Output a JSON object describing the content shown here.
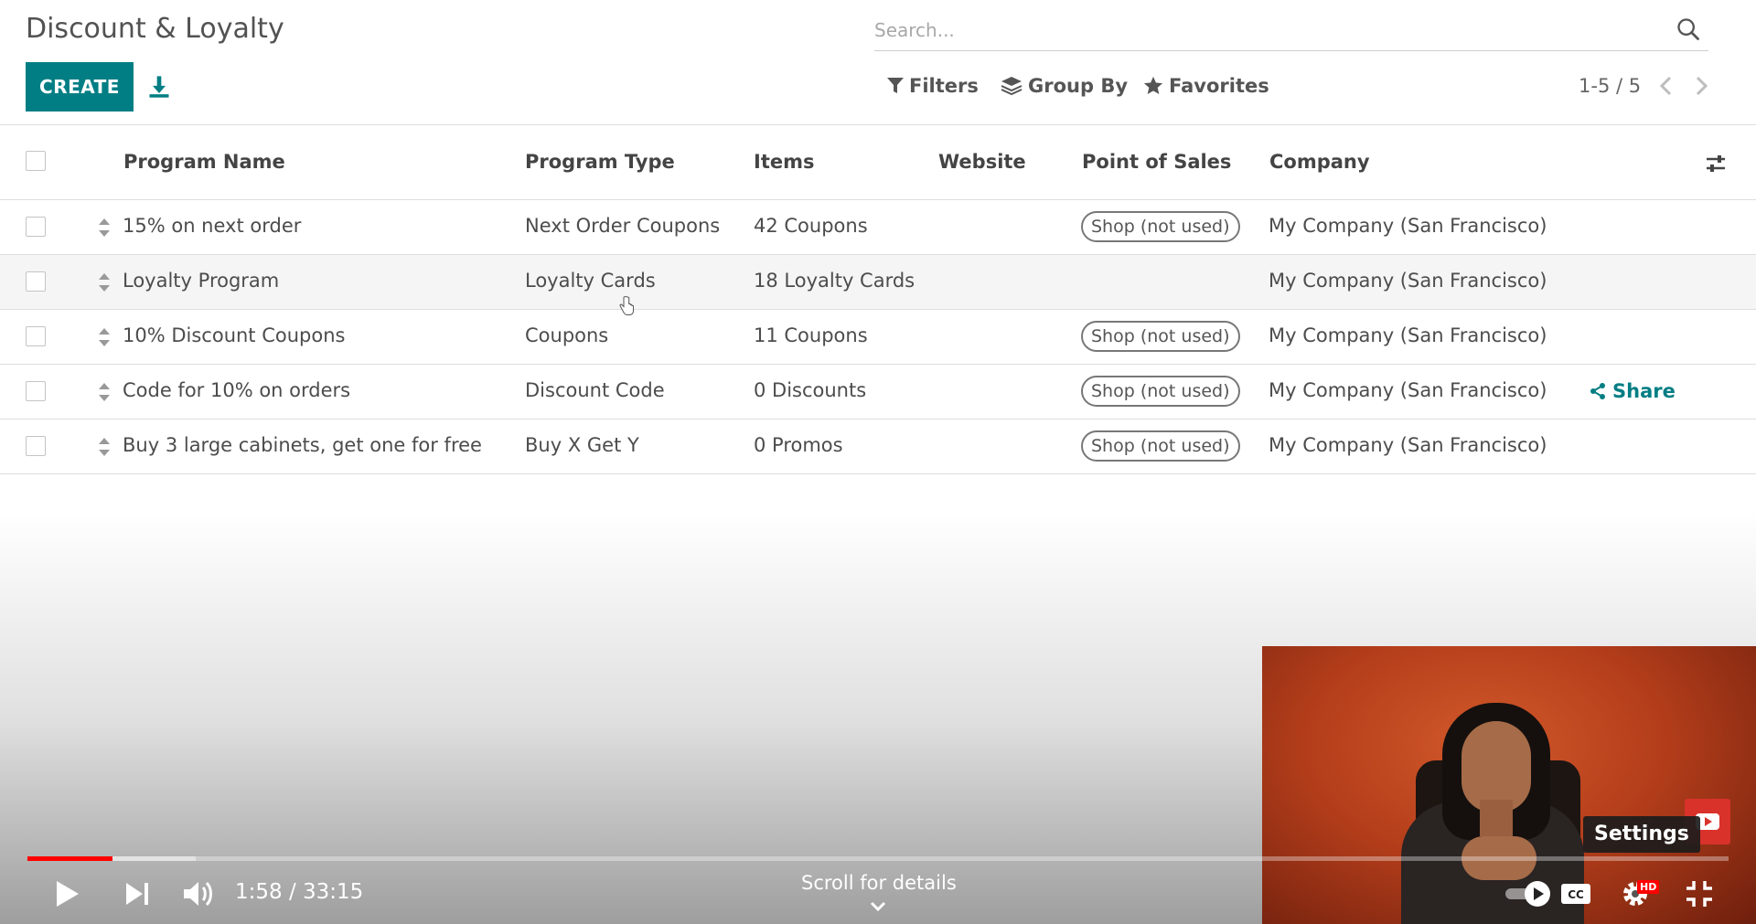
{
  "page": {
    "title": "Discount & Loyalty"
  },
  "search": {
    "placeholder": "Search..."
  },
  "toolbar": {
    "create_label": "CREATE",
    "filters_label": "Filters",
    "group_by_label": "Group By",
    "favorites_label": "Favorites",
    "pager": "1-5 / 5"
  },
  "table": {
    "columns": [
      "Program Name",
      "Program Type",
      "Items",
      "Website",
      "Point of Sales",
      "Company"
    ],
    "rows": [
      {
        "name": "15% on next order",
        "type": "Next Order Coupons",
        "items": "42 Coupons",
        "website": "",
        "pos": "Shop (not used)",
        "company": "My Company (San Francisco)",
        "action": ""
      },
      {
        "name": "Loyalty Program",
        "type": "Loyalty Cards",
        "items": "18 Loyalty Cards",
        "website": "",
        "pos": "",
        "company": "My Company (San Francisco)",
        "action": ""
      },
      {
        "name": "10% Discount Coupons",
        "type": "Coupons",
        "items": "11 Coupons",
        "website": "",
        "pos": "Shop (not used)",
        "company": "My Company (San Francisco)",
        "action": ""
      },
      {
        "name": "Code for 10% on orders",
        "type": "Discount Code",
        "items": "0 Discounts",
        "website": "",
        "pos": "Shop (not used)",
        "company": "My Company (San Francisco)",
        "action": "Share"
      },
      {
        "name": "Buy 3 large cabinets, get one for free",
        "type": "Buy X Get Y",
        "items": "0 Promos",
        "website": "",
        "pos": "Shop (not used)",
        "company": "My Company (San Francisco)",
        "action": ""
      }
    ]
  },
  "video": {
    "time": "1:58 / 33:15",
    "scroll_hint": "Scroll for details",
    "tooltip": "Settings",
    "played_fraction": 0.05,
    "buffered_fraction": 0.099,
    "quality_badge": "HD",
    "colors": {
      "played": "#ff0000",
      "accent": "#017e84"
    }
  }
}
